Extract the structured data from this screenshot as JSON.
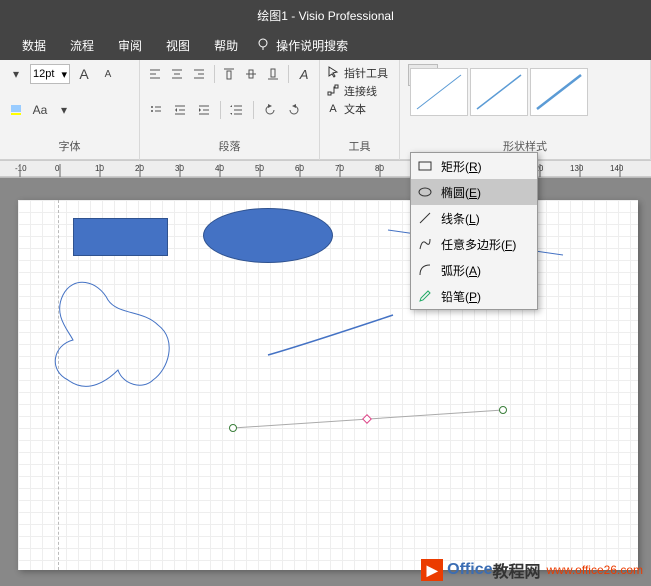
{
  "title": "绘图1  -  Visio Professional",
  "menu": {
    "data": "数据",
    "flow": "流程",
    "review": "审阅",
    "view": "视图",
    "help": "帮助",
    "tell": "操作说明搜索"
  },
  "font": {
    "size": "12pt",
    "aa_label": "Aa",
    "group": "字体"
  },
  "paragraph": {
    "group": "段落"
  },
  "tools": {
    "pointer": "指针工具",
    "connector": "连接线",
    "text": "文本",
    "group": "工具"
  },
  "styles": {
    "group": "形状样式"
  },
  "dropdown": {
    "rect": "矩形(R)",
    "ellipse": "椭圆(E)",
    "line": "线条(L)",
    "freeform": "任意多边形(F)",
    "arc": "弧形(A)",
    "pencil": "铅笔(P)"
  },
  "watermark": {
    "brand1": "Office",
    "brand2": "教程网",
    "url": "www.office26.com"
  }
}
